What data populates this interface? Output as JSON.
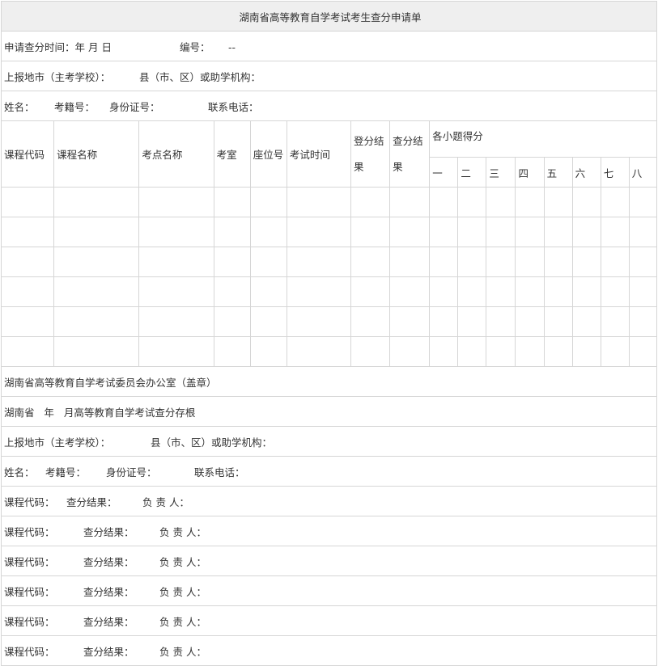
{
  "title": "湖南省高等教育自学考试考生查分申请单",
  "row1": {
    "apply_time": "申请查分时间：年  月  日",
    "number_label": "编号：",
    "number_value": "--"
  },
  "row2": {
    "city": "上报地市（主考学校）：",
    "county": "县（市、区）或助学机构："
  },
  "row3": {
    "name": "姓名：",
    "exam_no": "考籍号：",
    "id_no": "身份证号：",
    "phone": "联系电话："
  },
  "table_headers": {
    "course_code": "课程代码",
    "course_name": "课程名称",
    "exam_site": "考点名称",
    "room": "考室",
    "seat": "座位号",
    "exam_time": "考试时间",
    "reg_result": "登分结果",
    "check_result": "查分结果",
    "sub_scores": "各小题得分",
    "questions": [
      "一",
      "二",
      "三",
      "四",
      "五",
      "六",
      "七",
      "八"
    ]
  },
  "office": "湖南省高等教育自学考试委员会办公室（盖章）",
  "stub_title": "湖南省   年   月高等教育自学考试查分存根",
  "stub_row_city": {
    "city": "上报地市（主考学校）：",
    "county": "县（市、区）或助学机构："
  },
  "stub_row_info": {
    "name": "姓名：",
    "exam_no": "考籍号：",
    "id_no": "身份证号：",
    "phone": "联系电话："
  },
  "stub_lines": [
    {
      "code": "课程代码：",
      "result": "查分结果：",
      "person": "负 责 人："
    },
    {
      "code": "课程代码：",
      "result": "查分结果：",
      "person": "负 责 人："
    },
    {
      "code": "课程代码：",
      "result": "查分结果：",
      "person": "负 责 人："
    },
    {
      "code": "课程代码：",
      "result": "查分结果：",
      "person": "负 责 人："
    },
    {
      "code": "课程代码：",
      "result": "查分结果：",
      "person": "负 责 人："
    },
    {
      "code": "课程代码：",
      "result": "查分结果：",
      "person": "负 责 人："
    }
  ]
}
